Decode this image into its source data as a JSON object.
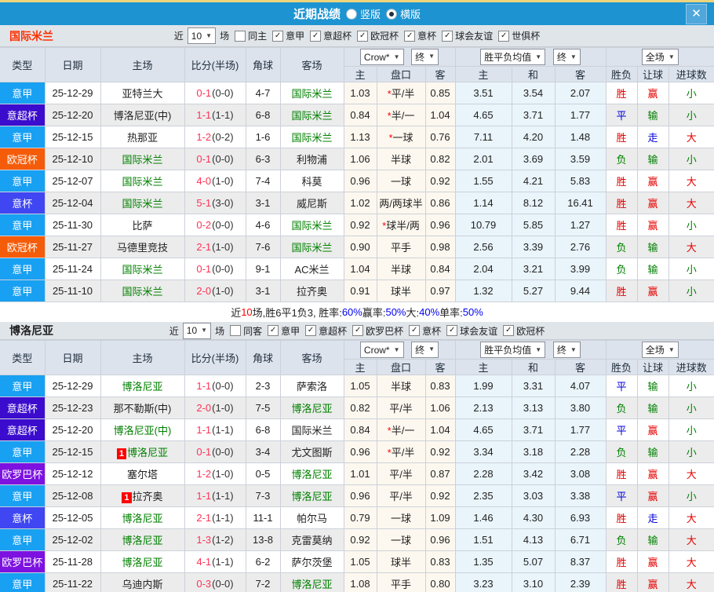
{
  "titlebar": {
    "title": "近期战绩",
    "radio_options": [
      {
        "label": "竖版",
        "selected": false
      },
      {
        "label": "横版",
        "selected": true
      }
    ]
  },
  "icons": {
    "caret": "▼",
    "close": "✕",
    "check": "✓",
    "star": "*"
  },
  "table_header": {
    "static_cols": [
      "类型",
      "日期",
      "主场",
      "比分(半场)",
      "角球",
      "客场"
    ],
    "odds_source": "Crow*",
    "time_label": "终",
    "avg_label": "胜平负均值",
    "scope_label": "全场",
    "odds_subcols": [
      "主",
      "盘口",
      "客"
    ],
    "avg_subcols": [
      "主",
      "和",
      "客"
    ],
    "result_subcols": [
      "胜负",
      "让球",
      "进球数"
    ]
  },
  "palette": {
    "titlebar_bg": "#1d94d1",
    "titlebar_strip": "#eed47c",
    "close_bg": "#4fa7dc",
    "header_bg": "#dce3ed",
    "section_bg": "#e0e5ea",
    "zebra": "#ececec",
    "odds_bg": "#fdf8ef",
    "avg_bg": "#e9f4fb",
    "score_ft": "#ff3355",
    "team_highlight": "#008000",
    "type_colors": {
      "意甲": "#18a0f2",
      "意超杯": "#3b0ccd",
      "欧冠杯": "#f55c09",
      "意杯": "#3f46f2",
      "欧罗巴杯": "#7d12e0"
    },
    "value_colors": {
      "胜": "#e60000",
      "平": "#0000dd",
      "负": "#008000",
      "赢": "#e60000",
      "走": "#0000dd",
      "输": "#008000",
      "大": "#e60000",
      "小": "#008000"
    }
  },
  "sections": [
    {
      "team": "国际米兰",
      "team_color": "#ff3000",
      "filters": {
        "near_label": "近",
        "count": "10",
        "games_label": "场",
        "toggle_label": "同主",
        "toggle_checked": false,
        "competitions": [
          {
            "label": "意甲",
            "checked": true
          },
          {
            "label": "意超杯",
            "checked": true
          },
          {
            "label": "欧冠杯",
            "checked": true
          },
          {
            "label": "意杯",
            "checked": true
          },
          {
            "label": "球会友谊",
            "checked": true
          },
          {
            "label": "世俱杯",
            "checked": true
          }
        ]
      },
      "rows": [
        {
          "type": "意甲",
          "date": "25-12-29",
          "home": "亚特兰大",
          "home_hl": false,
          "home_rc": "",
          "score": "0-1",
          "half": "(0-0)",
          "corners": "4-7",
          "away": "国际米兰",
          "away_hl": true,
          "o_home": "1.03",
          "star": true,
          "handicap": "平/半",
          "o_away": "0.85",
          "avg_w": "3.51",
          "avg_d": "3.54",
          "avg_l": "2.07",
          "res": "胜",
          "res_let": "赢",
          "res_goal": "小"
        },
        {
          "type": "意超杯",
          "date": "25-12-20",
          "home": "博洛尼亚(中)",
          "home_hl": false,
          "home_rc": "",
          "score": "1-1",
          "half": "(1-1)",
          "corners": "6-8",
          "away": "国际米兰",
          "away_hl": true,
          "o_home": "0.84",
          "star": true,
          "handicap": "半/一",
          "o_away": "1.04",
          "avg_w": "4.65",
          "avg_d": "3.71",
          "avg_l": "1.77",
          "res": "平",
          "res_let": "输",
          "res_goal": "小"
        },
        {
          "type": "意甲",
          "date": "25-12-15",
          "home": "热那亚",
          "home_hl": false,
          "home_rc": "",
          "score": "1-2",
          "half": "(0-2)",
          "corners": "1-6",
          "away": "国际米兰",
          "away_hl": true,
          "o_home": "1.13",
          "star": true,
          "handicap": "一球",
          "o_away": "0.76",
          "avg_w": "7.11",
          "avg_d": "4.20",
          "avg_l": "1.48",
          "res": "胜",
          "res_let": "走",
          "res_goal": "大"
        },
        {
          "type": "欧冠杯",
          "date": "25-12-10",
          "home": "国际米兰",
          "home_hl": true,
          "home_rc": "",
          "score": "0-1",
          "half": "(0-0)",
          "corners": "6-3",
          "away": "利物浦",
          "away_hl": false,
          "o_home": "1.06",
          "star": false,
          "handicap": "半球",
          "o_away": "0.82",
          "avg_w": "2.01",
          "avg_d": "3.69",
          "avg_l": "3.59",
          "res": "负",
          "res_let": "输",
          "res_goal": "小"
        },
        {
          "type": "意甲",
          "date": "25-12-07",
          "home": "国际米兰",
          "home_hl": true,
          "home_rc": "",
          "score": "4-0",
          "half": "(1-0)",
          "corners": "7-4",
          "away": "科莫",
          "away_hl": false,
          "o_home": "0.96",
          "star": false,
          "handicap": "一球",
          "o_away": "0.92",
          "avg_w": "1.55",
          "avg_d": "4.21",
          "avg_l": "5.83",
          "res": "胜",
          "res_let": "赢",
          "res_goal": "大"
        },
        {
          "type": "意杯",
          "date": "25-12-04",
          "home": "国际米兰",
          "home_hl": true,
          "home_rc": "",
          "score": "5-1",
          "half": "(3-0)",
          "corners": "3-1",
          "away": "威尼斯",
          "away_hl": false,
          "o_home": "1.02",
          "star": false,
          "handicap": "两/两球半",
          "o_away": "0.86",
          "avg_w": "1.14",
          "avg_d": "8.12",
          "avg_l": "16.41",
          "res": "胜",
          "res_let": "赢",
          "res_goal": "大"
        },
        {
          "type": "意甲",
          "date": "25-11-30",
          "home": "比萨",
          "home_hl": false,
          "home_rc": "",
          "score": "0-2",
          "half": "(0-0)",
          "corners": "4-6",
          "away": "国际米兰",
          "away_hl": true,
          "o_home": "0.92",
          "star": true,
          "handicap": "球半/两",
          "o_away": "0.96",
          "avg_w": "10.79",
          "avg_d": "5.85",
          "avg_l": "1.27",
          "res": "胜",
          "res_let": "赢",
          "res_goal": "小"
        },
        {
          "type": "欧冠杯",
          "date": "25-11-27",
          "home": "马德里竞技",
          "home_hl": false,
          "home_rc": "",
          "score": "2-1",
          "half": "(1-0)",
          "corners": "7-6",
          "away": "国际米兰",
          "away_hl": true,
          "o_home": "0.90",
          "star": false,
          "handicap": "平手",
          "o_away": "0.98",
          "avg_w": "2.56",
          "avg_d": "3.39",
          "avg_l": "2.76",
          "res": "负",
          "res_let": "输",
          "res_goal": "大"
        },
        {
          "type": "意甲",
          "date": "25-11-24",
          "home": "国际米兰",
          "home_hl": true,
          "home_rc": "",
          "score": "0-1",
          "half": "(0-0)",
          "corners": "9-1",
          "away": "AC米兰",
          "away_hl": false,
          "o_home": "1.04",
          "star": false,
          "handicap": "半球",
          "o_away": "0.84",
          "avg_w": "2.04",
          "avg_d": "3.21",
          "avg_l": "3.99",
          "res": "负",
          "res_let": "输",
          "res_goal": "小"
        },
        {
          "type": "意甲",
          "date": "25-11-10",
          "home": "国际米兰",
          "home_hl": true,
          "home_rc": "",
          "score": "2-0",
          "half": "(1-0)",
          "corners": "3-1",
          "away": "拉齐奥",
          "away_hl": false,
          "o_home": "0.91",
          "star": false,
          "handicap": "球半",
          "o_away": "0.97",
          "avg_w": "1.32",
          "avg_d": "5.27",
          "avg_l": "9.44",
          "res": "胜",
          "res_let": "赢",
          "res_goal": "小"
        }
      ],
      "summary": [
        {
          "text": "近",
          "color": "#222222"
        },
        {
          "text": "10",
          "color": "#ff0000"
        },
        {
          "text": "场,胜6平1负3, 胜率:",
          "color": "#222222"
        },
        {
          "text": "60%",
          "color": "#0000ee"
        },
        {
          "text": " 赢率:",
          "color": "#222222"
        },
        {
          "text": "50%",
          "color": "#0000ee"
        },
        {
          "text": " 大:",
          "color": "#222222"
        },
        {
          "text": "40%",
          "color": "#0000ee"
        },
        {
          "text": " 单率:",
          "color": "#222222"
        },
        {
          "text": "50%",
          "color": "#0000ee"
        }
      ]
    },
    {
      "team": "博洛尼亚",
      "team_color": "#222222",
      "filters": {
        "near_label": "近",
        "count": "10",
        "games_label": "场",
        "toggle_label": "同客",
        "toggle_checked": false,
        "competitions": [
          {
            "label": "意甲",
            "checked": true
          },
          {
            "label": "意超杯",
            "checked": true
          },
          {
            "label": "欧罗巴杯",
            "checked": true
          },
          {
            "label": "意杯",
            "checked": true
          },
          {
            "label": "球会友谊",
            "checked": true
          },
          {
            "label": "欧冠杯",
            "checked": true
          }
        ]
      },
      "rows": [
        {
          "type": "意甲",
          "date": "25-12-29",
          "home": "博洛尼亚",
          "home_hl": true,
          "home_rc": "",
          "score": "1-1",
          "half": "(0-0)",
          "corners": "2-3",
          "away": "萨索洛",
          "away_hl": false,
          "o_home": "1.05",
          "star": false,
          "handicap": "半球",
          "o_away": "0.83",
          "avg_w": "1.99",
          "avg_d": "3.31",
          "avg_l": "4.07",
          "res": "平",
          "res_let": "输",
          "res_goal": "小"
        },
        {
          "type": "意超杯",
          "date": "25-12-23",
          "home": "那不勒斯(中)",
          "home_hl": false,
          "home_rc": "",
          "score": "2-0",
          "half": "(1-0)",
          "corners": "7-5",
          "away": "博洛尼亚",
          "away_hl": true,
          "o_home": "0.82",
          "star": false,
          "handicap": "平/半",
          "o_away": "1.06",
          "avg_w": "2.13",
          "avg_d": "3.13",
          "avg_l": "3.80",
          "res": "负",
          "res_let": "输",
          "res_goal": "小"
        },
        {
          "type": "意超杯",
          "date": "25-12-20",
          "home": "博洛尼亚(中)",
          "home_hl": true,
          "home_rc": "",
          "score": "1-1",
          "half": "(1-1)",
          "corners": "6-8",
          "away": "国际米兰",
          "away_hl": false,
          "o_home": "0.84",
          "star": true,
          "handicap": "半/一",
          "o_away": "1.04",
          "avg_w": "4.65",
          "avg_d": "3.71",
          "avg_l": "1.77",
          "res": "平",
          "res_let": "赢",
          "res_goal": "小"
        },
        {
          "type": "意甲",
          "date": "25-12-15",
          "home": "博洛尼亚",
          "home_hl": true,
          "home_rc": "1",
          "score": "0-1",
          "half": "(0-0)",
          "corners": "3-4",
          "away": "尤文图斯",
          "away_hl": false,
          "o_home": "0.96",
          "star": true,
          "handicap": "平/半",
          "o_away": "0.92",
          "avg_w": "3.34",
          "avg_d": "3.18",
          "avg_l": "2.28",
          "res": "负",
          "res_let": "输",
          "res_goal": "小"
        },
        {
          "type": "欧罗巴杯",
          "date": "25-12-12",
          "home": "塞尔塔",
          "home_hl": false,
          "home_rc": "",
          "score": "1-2",
          "half": "(1-0)",
          "corners": "0-5",
          "away": "博洛尼亚",
          "away_hl": true,
          "o_home": "1.01",
          "star": false,
          "handicap": "平/半",
          "o_away": "0.87",
          "avg_w": "2.28",
          "avg_d": "3.42",
          "avg_l": "3.08",
          "res": "胜",
          "res_let": "赢",
          "res_goal": "大"
        },
        {
          "type": "意甲",
          "date": "25-12-08",
          "home": "拉齐奥",
          "home_hl": false,
          "home_rc": "1",
          "score": "1-1",
          "half": "(1-1)",
          "corners": "7-3",
          "away": "博洛尼亚",
          "away_hl": true,
          "o_home": "0.96",
          "star": false,
          "handicap": "平/半",
          "o_away": "0.92",
          "avg_w": "2.35",
          "avg_d": "3.03",
          "avg_l": "3.38",
          "res": "平",
          "res_let": "赢",
          "res_goal": "小"
        },
        {
          "type": "意杯",
          "date": "25-12-05",
          "home": "博洛尼亚",
          "home_hl": true,
          "home_rc": "",
          "score": "2-1",
          "half": "(1-1)",
          "corners": "11-1",
          "away": "帕尔马",
          "away_hl": false,
          "o_home": "0.79",
          "star": false,
          "handicap": "一球",
          "o_away": "1.09",
          "avg_w": "1.46",
          "avg_d": "4.30",
          "avg_l": "6.93",
          "res": "胜",
          "res_let": "走",
          "res_goal": "大"
        },
        {
          "type": "意甲",
          "date": "25-12-02",
          "home": "博洛尼亚",
          "home_hl": true,
          "home_rc": "",
          "score": "1-3",
          "half": "(1-2)",
          "corners": "13-8",
          "away": "克雷莫纳",
          "away_hl": false,
          "o_home": "0.92",
          "star": false,
          "handicap": "一球",
          "o_away": "0.96",
          "avg_w": "1.51",
          "avg_d": "4.13",
          "avg_l": "6.71",
          "res": "负",
          "res_let": "输",
          "res_goal": "大"
        },
        {
          "type": "欧罗巴杯",
          "date": "25-11-28",
          "home": "博洛尼亚",
          "home_hl": true,
          "home_rc": "",
          "score": "4-1",
          "half": "(1-1)",
          "corners": "6-2",
          "away": "萨尔茨堡",
          "away_hl": false,
          "o_home": "1.05",
          "star": false,
          "handicap": "球半",
          "o_away": "0.83",
          "avg_w": "1.35",
          "avg_d": "5.07",
          "avg_l": "8.37",
          "res": "胜",
          "res_let": "赢",
          "res_goal": "大"
        },
        {
          "type": "意甲",
          "date": "25-11-22",
          "home": "乌迪内斯",
          "home_hl": false,
          "home_rc": "",
          "score": "0-3",
          "half": "(0-0)",
          "corners": "7-2",
          "away": "博洛尼亚",
          "away_hl": true,
          "o_home": "1.08",
          "star": false,
          "handicap": "平手",
          "o_away": "0.80",
          "avg_w": "3.23",
          "avg_d": "3.10",
          "avg_l": "2.39",
          "res": "胜",
          "res_let": "赢",
          "res_goal": "大"
        }
      ],
      "summary": []
    }
  ]
}
